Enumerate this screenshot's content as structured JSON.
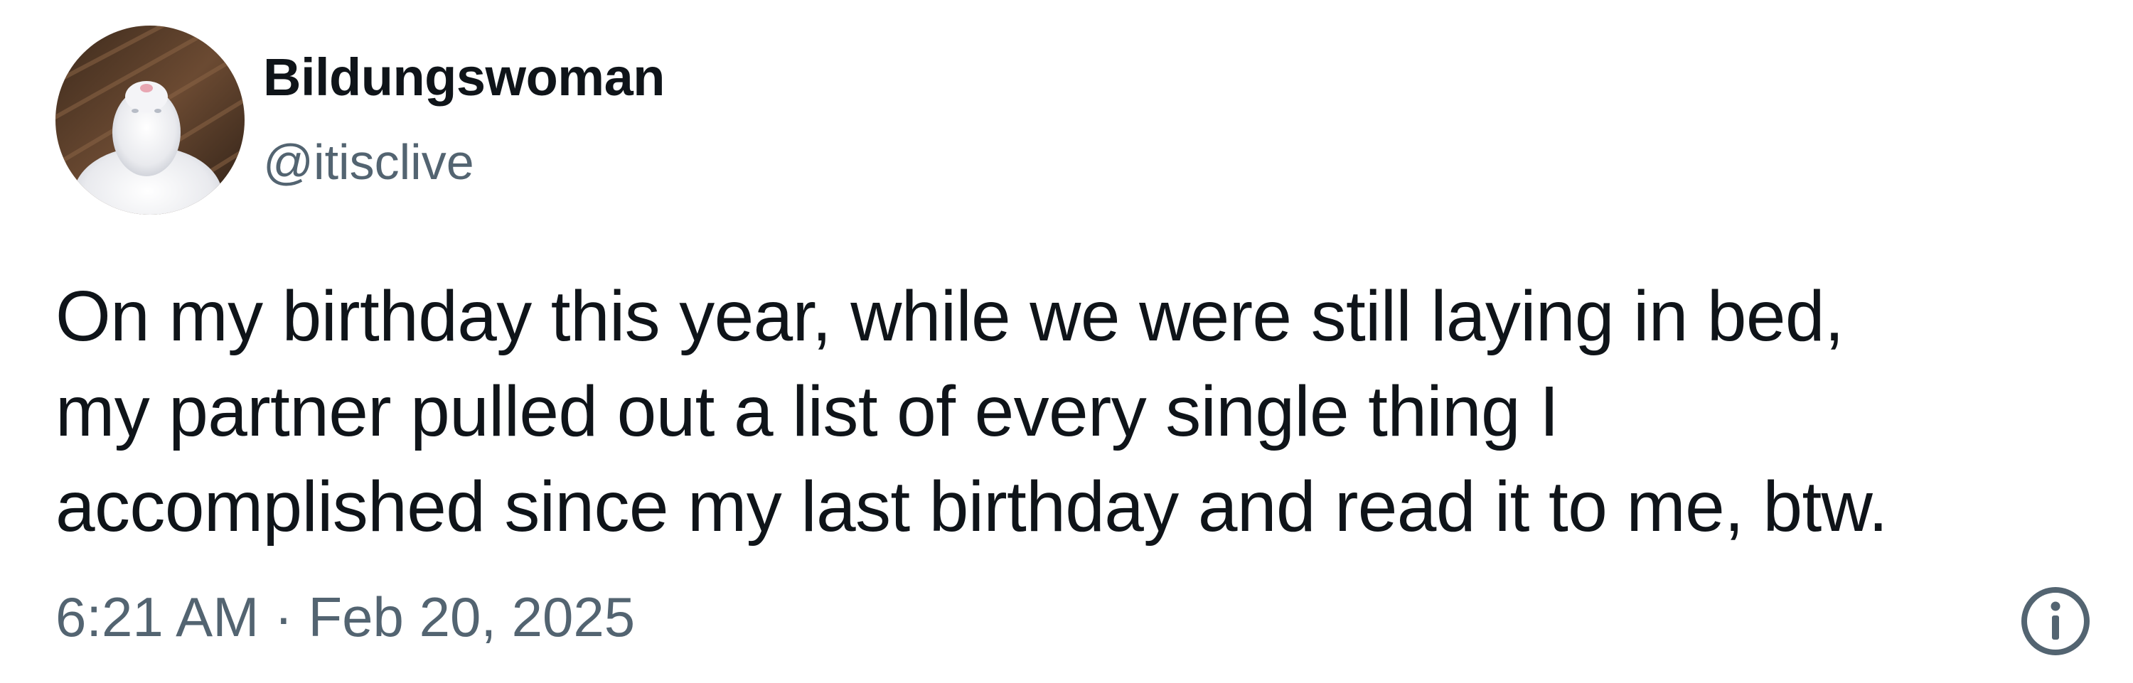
{
  "author": {
    "display_name": "Bildungswoman",
    "handle": "@itisclive",
    "avatar_icon": "white-cat-avatar"
  },
  "tweet": {
    "text_lines": [
      "On my birthday this year, while we were still laying in bed,",
      "my partner pulled out a list of every single thing I",
      "accomplished since my last birthday and read it to me, btw."
    ],
    "timestamp": "6:21 AM · Feb 20, 2025"
  },
  "icons": {
    "info": "info-icon"
  },
  "colors": {
    "primary_text": "#0f1419",
    "secondary_text": "#536471",
    "background": "#ffffff"
  }
}
